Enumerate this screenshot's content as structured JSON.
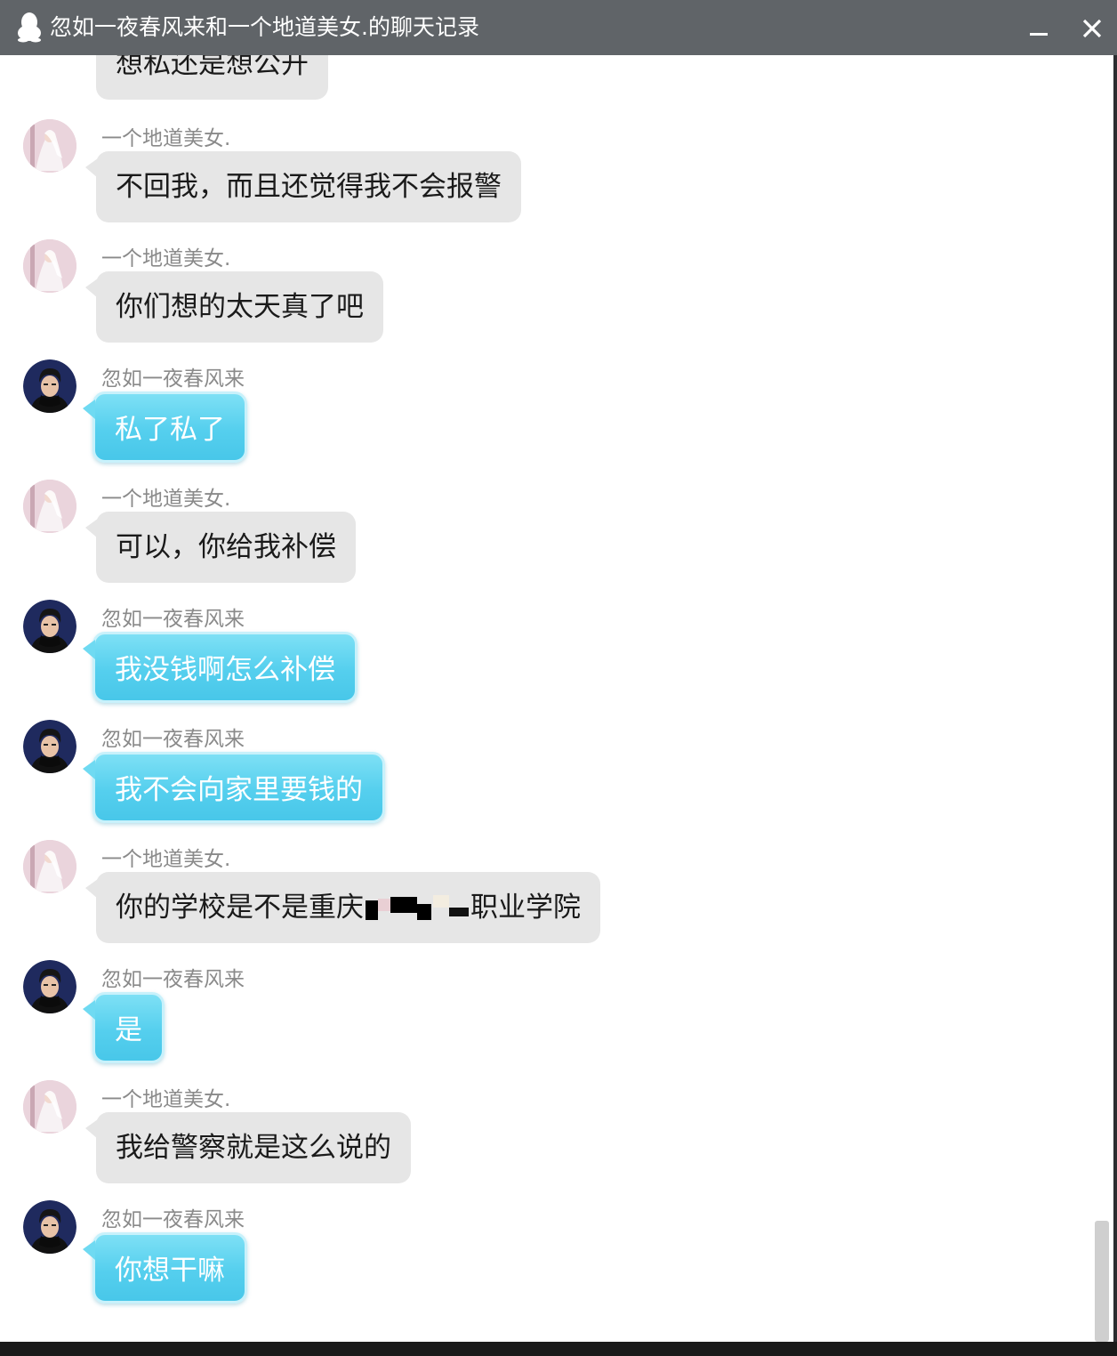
{
  "window": {
    "title": "忽如一夜春风来和一个地道美女.的聊天记录",
    "icons": {
      "app": "qq-penguin-icon",
      "minimize": "minimize-icon",
      "close": "close-icon"
    }
  },
  "colors": {
    "titlebar": "#606468",
    "her_bubble": "#e6e6e6",
    "his_bubble": "#55cfee",
    "sender_name": "#8a8a8a"
  },
  "top_partial_message": {
    "text": "想私还是想公开"
  },
  "messages": [
    {
      "sender": "一个地道美女.",
      "side": "her",
      "text": "不回我，而且还觉得我不会报警"
    },
    {
      "sender": "一个地道美女.",
      "side": "her",
      "text": "你们想的太天真了吧"
    },
    {
      "sender": "忽如一夜春风来",
      "side": "him",
      "text": "私了私了"
    },
    {
      "sender": "一个地道美女.",
      "side": "her",
      "text": "可以，你给我补偿"
    },
    {
      "sender": "忽如一夜春风来",
      "side": "him",
      "text": "我没钱啊怎么补偿"
    },
    {
      "sender": "忽如一夜春风来",
      "side": "him",
      "text": "我不会向家里要钱的"
    },
    {
      "sender": "一个地道美女.",
      "side": "her",
      "text_before": "你的学校是不是重庆",
      "text_after": "职业学院",
      "redacted": true
    },
    {
      "sender": "忽如一夜春风来",
      "side": "him",
      "text": "是"
    },
    {
      "sender": "一个地道美女.",
      "side": "her",
      "text": "我给警察就是这么说的"
    },
    {
      "sender": "忽如一夜春风来",
      "side": "him",
      "text": "你想干嘛"
    }
  ]
}
